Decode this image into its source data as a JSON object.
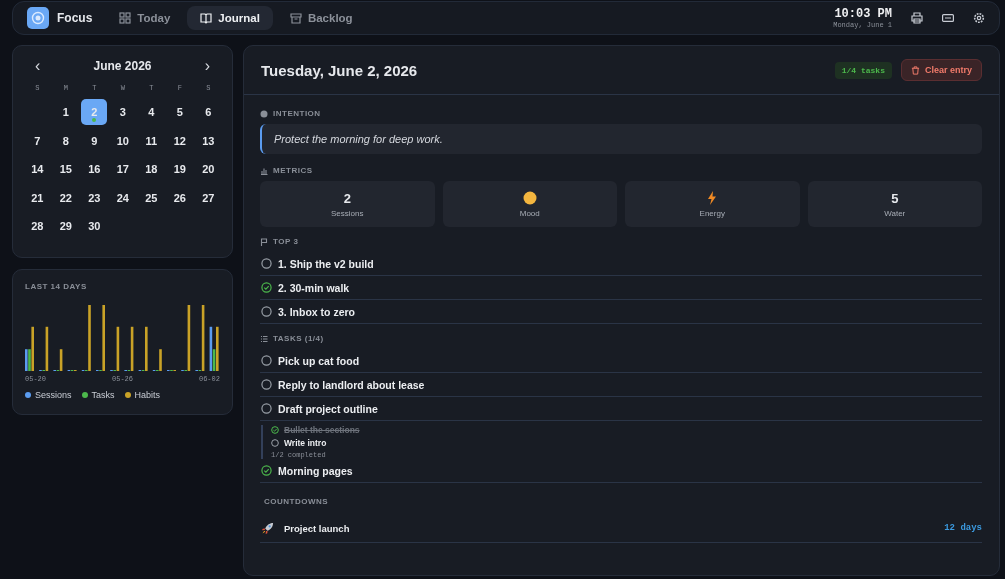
{
  "app": {
    "name": "Focus"
  },
  "nav": [
    {
      "label": "Today",
      "kind": "grid",
      "selected": false
    },
    {
      "label": "Journal",
      "kind": "book",
      "selected": true
    },
    {
      "label": "Backlog",
      "kind": "archive",
      "selected": false
    }
  ],
  "clock": {
    "time": "10:03 PM",
    "date": "Monday, June 1"
  },
  "calendar": {
    "month": "June 2026",
    "prev": "‹",
    "next": "›",
    "weekdays": [
      "S",
      "M",
      "T",
      "W",
      "T",
      "F",
      "S"
    ],
    "days": [
      {
        "day": "1",
        "selected": false,
        "has_entry": false
      },
      {
        "day": "2",
        "selected": true,
        "has_entry": true
      },
      {
        "day": "3",
        "selected": false,
        "has_entry": false
      },
      {
        "day": "4",
        "selected": false,
        "has_entry": false
      },
      {
        "day": "5",
        "selected": false,
        "has_entry": false
      },
      {
        "day": "6",
        "selected": false,
        "has_entry": false
      },
      {
        "day": "7",
        "selected": false,
        "has_entry": false
      },
      {
        "day": "8",
        "selected": false,
        "has_entry": false
      },
      {
        "day": "9",
        "selected": false,
        "has_entry": false
      },
      {
        "day": "10",
        "selected": false,
        "has_entry": false
      },
      {
        "day": "11",
        "selected": false,
        "has_entry": false
      },
      {
        "day": "12",
        "selected": false,
        "has_entry": false
      },
      {
        "day": "13",
        "selected": false,
        "has_entry": false
      },
      {
        "day": "14",
        "selected": false,
        "has_entry": false
      },
      {
        "day": "15",
        "selected": false,
        "has_entry": false
      },
      {
        "day": "16",
        "selected": false,
        "has_entry": false
      },
      {
        "day": "17",
        "selected": false,
        "has_entry": false
      },
      {
        "day": "18",
        "selected": false,
        "has_entry": false
      },
      {
        "day": "19",
        "selected": false,
        "has_entry": false
      },
      {
        "day": "20",
        "selected": false,
        "has_entry": false
      },
      {
        "day": "21",
        "selected": false,
        "has_entry": false
      },
      {
        "day": "22",
        "selected": false,
        "has_entry": false
      },
      {
        "day": "23",
        "selected": false,
        "has_entry": false
      },
      {
        "day": "24",
        "selected": false,
        "has_entry": false
      },
      {
        "day": "25",
        "selected": false,
        "has_entry": false
      },
      {
        "day": "26",
        "selected": false,
        "has_entry": false
      },
      {
        "day": "27",
        "selected": false,
        "has_entry": false
      },
      {
        "day": "28",
        "selected": false,
        "has_entry": false
      },
      {
        "day": "29",
        "selected": false,
        "has_entry": false
      },
      {
        "day": "30",
        "selected": false,
        "has_entry": false
      }
    ]
  },
  "history": {
    "title": "LAST 14 DAYS",
    "x_labels": [
      "05-20",
      "05-26",
      "06-02"
    ],
    "legend": [
      {
        "label": "Sessions",
        "color": "#5b9cf0"
      },
      {
        "label": "Tasks",
        "color": "#4cb84c"
      },
      {
        "label": "Habits",
        "color": "#c9a227"
      }
    ]
  },
  "entry": {
    "title": "Tuesday, June 2, 2026",
    "badge": "1/4 tasks",
    "clear_button": "Clear entry",
    "intention": {
      "heading": "INTENTION",
      "text": "Protect the morning for deep work."
    },
    "metrics": {
      "heading": "METRICS",
      "items": [
        {
          "kind": "number",
          "value": "2",
          "label": "Sessions"
        },
        {
          "kind": "mood",
          "label": "Mood"
        },
        {
          "kind": "energy",
          "label": "Energy"
        },
        {
          "kind": "number",
          "value": "5",
          "label": "Water"
        }
      ]
    },
    "top3": {
      "heading": "TOP 3",
      "items": [
        {
          "text": "1. Ship the v2 build",
          "checked": false
        },
        {
          "text": "2. 30-min walk",
          "checked": true
        },
        {
          "text": "3. Inbox to zero",
          "checked": false
        }
      ]
    },
    "tasks": {
      "heading": "TASKS (1/4)",
      "items": [
        {
          "text": "Pick up cat food",
          "checked": false
        },
        {
          "text": "Reply to landlord about lease",
          "checked": false
        },
        {
          "text": "Draft project outline",
          "checked": false,
          "subtasks": [
            {
              "text": "Bullet the sections",
              "checked": true
            },
            {
              "text": "Write intro",
              "checked": false
            }
          ],
          "summary": "1/2 completed"
        },
        {
          "text": "Morning pages",
          "checked": true
        }
      ]
    },
    "countdowns": {
      "heading": "COUNTDOWNS",
      "items": [
        {
          "name": "Project launch",
          "remaining": "12 days"
        }
      ]
    }
  }
}
